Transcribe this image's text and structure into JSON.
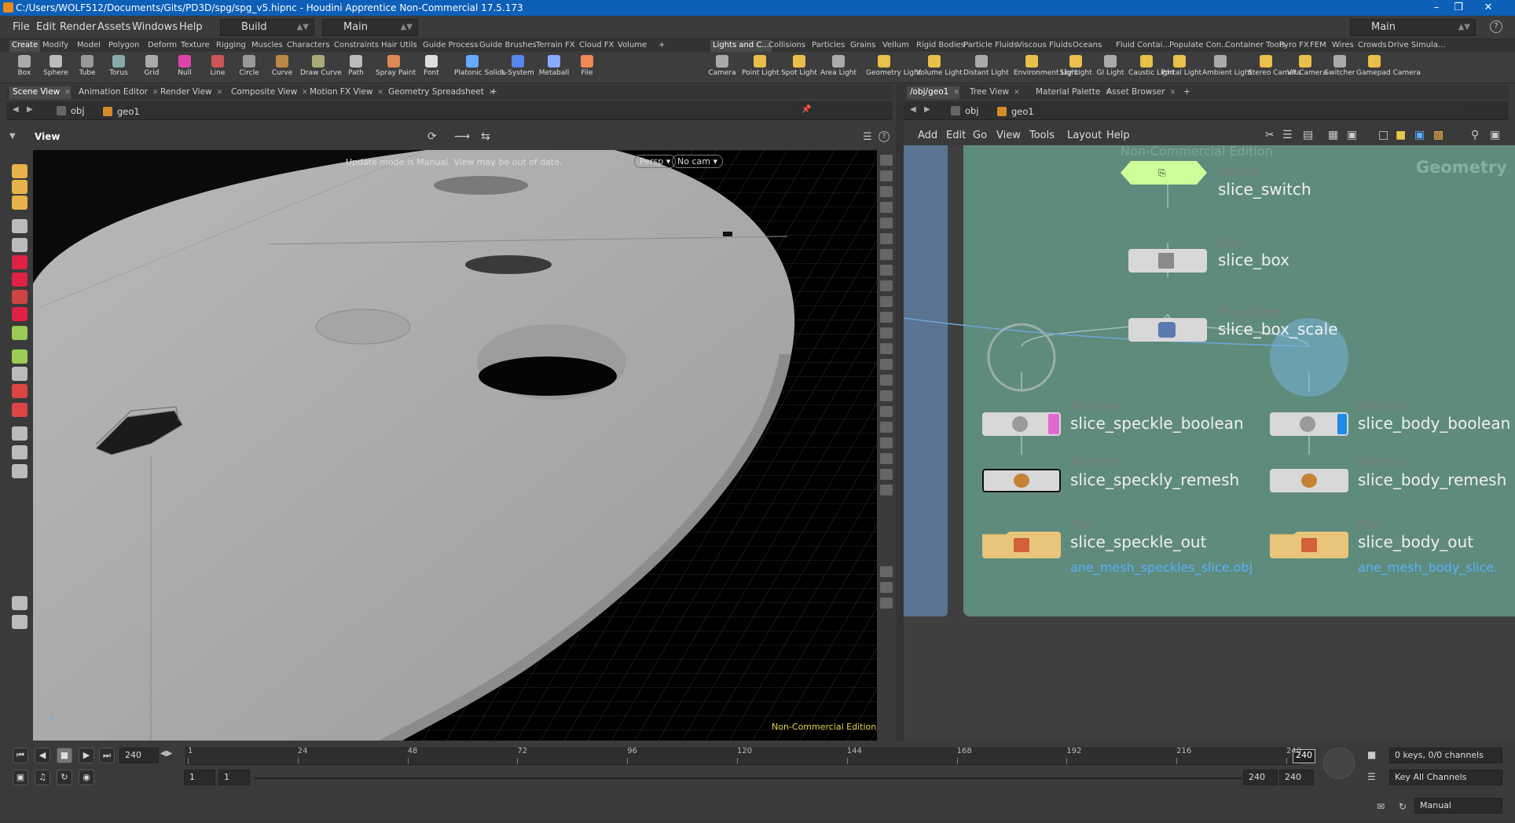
{
  "window": {
    "title": "C:/Users/WOLF512/Documents/Gits/PD3D/spg/spg_v5.hipnc - Houdini Apprentice Non-Commercial 17.5.173"
  },
  "menubar": {
    "items": [
      "File",
      "Edit",
      "Render",
      "Assets",
      "Windows",
      "Help"
    ],
    "desktop": "Build",
    "context": "Main",
    "right_desktop": "Main"
  },
  "shelf_left": {
    "tabs": [
      "Create",
      "Modify",
      "Model",
      "Polygon",
      "Deform",
      "Texture",
      "Rigging",
      "Muscles",
      "Characters",
      "Constraints",
      "Hair Utils",
      "Guide Process",
      "Guide Brushes",
      "Terrain FX",
      "Cloud FX",
      "Volume"
    ],
    "tools": [
      "Box",
      "Sphere",
      "Tube",
      "Torus",
      "Grid",
      "Null",
      "Line",
      "Circle",
      "Curve",
      "Draw Curve",
      "Path",
      "Spray Paint",
      "Font",
      "Platonic Solids",
      "L-System",
      "Metaball",
      "File"
    ]
  },
  "shelf_right": {
    "tabs": [
      "Lights and C...",
      "Collisions",
      "Particles",
      "Grains",
      "Vellum",
      "Rigid Bodies",
      "Particle Fluids",
      "Viscous Fluids",
      "Oceans",
      "Fluid Contai...",
      "Populate Con...",
      "Container Tools",
      "Pyro FX",
      "FEM",
      "Wires",
      "Crowds",
      "Drive Simula..."
    ],
    "tools": [
      "Camera",
      "Point Light",
      "Spot Light",
      "Area Light",
      "Geometry Light",
      "Volume Light",
      "Distant Light",
      "Environment Light",
      "Sky Light",
      "GI Light",
      "Caustic Light",
      "Portal Light",
      "Ambient Light",
      "Stereo Camera",
      "VR Camera",
      "Switcher",
      "Gamepad Camera"
    ]
  },
  "left_pane": {
    "tabs": [
      "Scene View",
      "Animation Editor",
      "Render View",
      "Composite View",
      "Motion FX View",
      "Geometry Spreadsheet"
    ],
    "path": [
      "obj",
      "geo1"
    ],
    "view_label": "View",
    "warning": "Update mode is Manual. View may be out of date.",
    "persp": "Persp",
    "cam": "No cam",
    "watermark": "Non-Commercial Edition"
  },
  "right_pane": {
    "tabs": [
      "/obj/geo1",
      "Tree View",
      "Material Palette",
      "Asset Browser"
    ],
    "path": [
      "obj",
      "geo1"
    ],
    "menu": [
      "Add",
      "Edit",
      "Go",
      "View",
      "Tools",
      "Layout",
      "Help"
    ],
    "network_label": "Geometry",
    "network_watermark": "Non-Commercial Edition",
    "nodes": [
      {
        "type": "Switch",
        "name": "slice_switch"
      },
      {
        "type": "Box",
        "name": "slice_box"
      },
      {
        "type": "Transform",
        "name": "slice_box_scale"
      },
      {
        "type": "Boolean",
        "name": "slice_speckle_boolean"
      },
      {
        "type": "Boolean",
        "name": "slice_body_boolean"
      },
      {
        "type": "Remesh",
        "name": "slice_speckly_remesh"
      },
      {
        "type": "Remesh",
        "name": "slice_body_remesh"
      },
      {
        "type": "File",
        "name": "slice_speckle_out",
        "file": "ane_mesh_speckles_slice.obj"
      },
      {
        "type": "File",
        "name": "slice_body_out",
        "file": "ane_mesh_body_slice."
      }
    ]
  },
  "timeline": {
    "current_frame": "240",
    "ticks": [
      "1",
      "24",
      "48",
      "72",
      "96",
      "120",
      "144",
      "168",
      "192",
      "216",
      "240"
    ],
    "marker": "240",
    "range_start": "1",
    "range_start2": "1",
    "range_end": "240",
    "range_end2": "240",
    "keys_info": "0 keys, 0/0 channels",
    "key_channels": "Key All Channels",
    "update_mode": "Manual"
  }
}
